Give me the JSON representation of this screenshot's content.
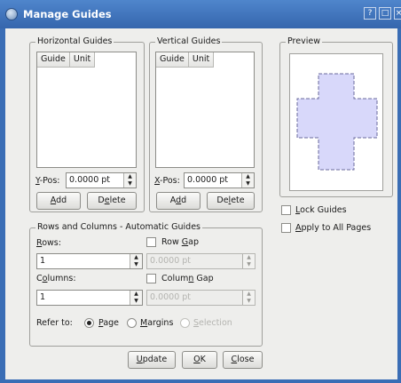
{
  "window": {
    "title": "Manage Guides",
    "help_label": "?",
    "maximize_label": "□",
    "close_label": "×"
  },
  "horizontal": {
    "group_title": "Horizontal Guides",
    "col_guide": "Guide",
    "col_unit": "Unit",
    "pos_label_mnemonic": "Y",
    "pos_label_rest": "-Pos:",
    "pos_value": "0.0000 pt",
    "add_mnemonic": "A",
    "add_rest": "dd",
    "delete_pre": "D",
    "delete_mnemonic": "e",
    "delete_post": "lete"
  },
  "vertical": {
    "group_title": "Vertical Guides",
    "col_guide": "Guide",
    "col_unit": "Unit",
    "pos_label_mnemonic": "X",
    "pos_label_rest": "-Pos:",
    "pos_value": "0.0000 pt",
    "add_pre": "A",
    "add_mnemonic": "d",
    "add_post": "d",
    "delete_pre": "De",
    "delete_mnemonic": "l",
    "delete_post": "ete"
  },
  "rows_cols": {
    "group_title": "Rows and Columns - Automatic Guides",
    "rows_mnemonic": "R",
    "rows_rest": "ows:",
    "rows_value": "1",
    "row_gap_pre": "Row ",
    "row_gap_mnemonic": "G",
    "row_gap_post": "ap",
    "row_gap_value": "0.0000 pt",
    "columns_pre": "C",
    "columns_mnemonic": "o",
    "columns_post": "lumns:",
    "columns_value": "1",
    "col_gap_pre": "Colum",
    "col_gap_mnemonic": "n",
    "col_gap_post": " Gap",
    "col_gap_value": "0.0000 pt",
    "refer_to_label": "Refer to:",
    "page_mnemonic": "P",
    "page_rest": "age",
    "margins_mnemonic": "M",
    "margins_rest": "argins",
    "selection_mnemonic": "S",
    "selection_rest": "election"
  },
  "preview": {
    "group_title": "Preview",
    "fill_color": "#d8d8fa",
    "stroke_color": "#6a6a9c"
  },
  "options": {
    "lock_mnemonic": "L",
    "lock_rest": "ock Guides",
    "apply_mnemonic": "A",
    "apply_rest": "pply to All Pages"
  },
  "buttons": {
    "update_mnemonic": "U",
    "update_rest": "pdate",
    "ok_mnemonic": "O",
    "ok_rest": "K",
    "close_mnemonic": "C",
    "close_rest": "lose"
  }
}
